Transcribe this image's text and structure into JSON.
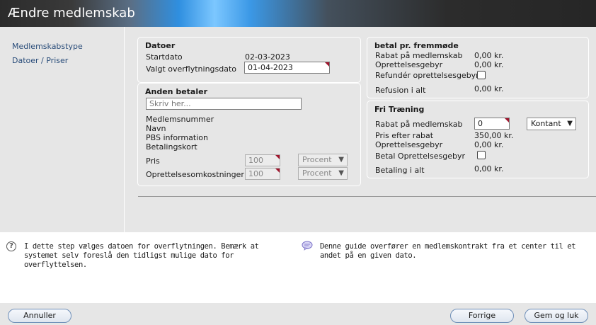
{
  "window": {
    "title": "Ændre medlemskab"
  },
  "nav": {
    "items": [
      "Medlemskabstype",
      "Datoer / Priser"
    ]
  },
  "datoer": {
    "title": "Datoer",
    "startdato_label": "Startdato",
    "startdato_value": "02-03-2023",
    "overflytning_label": "Valgt overflytningsdato",
    "overflytning_value": "01-04-2023"
  },
  "anden_betaler": {
    "title": "Anden betaler",
    "placeholder": "Skriv her...",
    "rows": [
      "Medlemsnummer",
      "Navn",
      "PBS information",
      "Betalingskort"
    ],
    "pris_label": "Pris",
    "pris_value": "100",
    "pris_type": "Procent",
    "opret_label": "Oprettelsesomkostninger",
    "opret_value": "100",
    "opret_type": "Procent"
  },
  "betal_fremmode": {
    "title": "betal pr. fremmøde",
    "rabat_label": "Rabat på medlemskab",
    "rabat_value": "0,00 kr.",
    "opret_label": "Oprettelsesgebyr",
    "opret_value": "0,00 kr.",
    "refunder_label": "Refundér oprettelsesgebyr",
    "refusion_label": "Refusion i alt",
    "refusion_value": "0,00 kr."
  },
  "fri_traening": {
    "title": "Fri Træning",
    "rabat_label": "Rabat på medlemskab",
    "rabat_value": "0",
    "betalingsmaade": "Kontant",
    "pris_label": "Pris efter rabat",
    "pris_value": "350,00 kr.",
    "opret_label": "Oprettelsesgebyr",
    "opret_value": "0,00 kr.",
    "betal_opret_label": "Betal Oprettelsesgebyr",
    "betaling_label": "Betaling i alt",
    "betaling_value": "0,00 kr."
  },
  "help": {
    "left_text": "I dette step vælges datoen for overflytningen. Bemærk at systemet selv foreslå den tidligst mulige dato for overflyttelsen.",
    "right_text": "Denne guide overfører en medlemskontrakt fra et center til et andet på en given dato."
  },
  "footer": {
    "cancel_label": "Annuller",
    "prev_label": "Forrige",
    "save_label": "Gem og luk"
  },
  "colors": {
    "accent": "#2f8fe0",
    "required_marker": "#a0142c",
    "link": "#2a4d7a"
  }
}
